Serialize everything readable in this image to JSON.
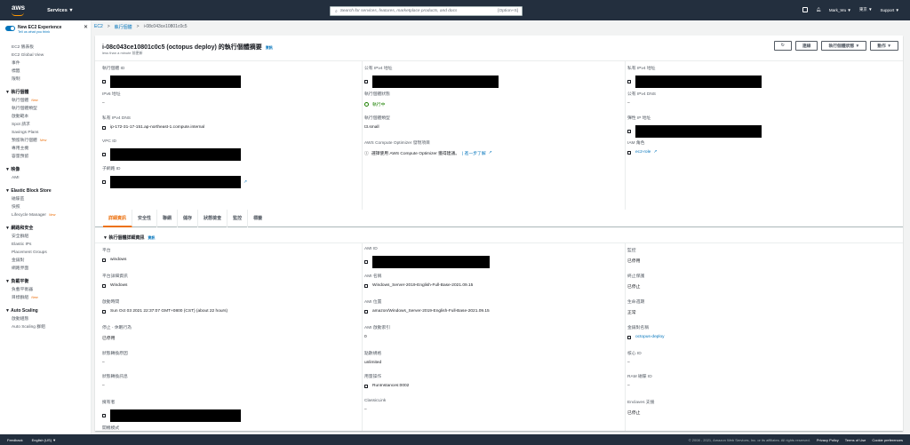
{
  "topbar": {
    "logo": "aws",
    "services_label": "Services ▼",
    "search_placeholder": "Search for services, features, marketplace products, and docs",
    "search_shortcut": "[Option+S]",
    "user": "Mark_Wu ▼",
    "region": "東京 ▼",
    "support": "Support ▼"
  },
  "sidebar": {
    "experience_title": "New EC2 Experience",
    "experience_sub": "Tell us what you think",
    "close": "✕",
    "items": [
      {
        "type": "item",
        "label": "EC2 儀表板"
      },
      {
        "type": "item",
        "label": "EC2 Global View"
      },
      {
        "type": "item",
        "label": "事件"
      },
      {
        "type": "item",
        "label": "標籤"
      },
      {
        "type": "item",
        "label": "限制"
      },
      {
        "type": "section",
        "label": "▼ 執行個體"
      },
      {
        "type": "item",
        "label": "執行個體",
        "badge": "New"
      },
      {
        "type": "item",
        "label": "執行個體類型"
      },
      {
        "type": "item",
        "label": "啟動範本"
      },
      {
        "type": "item",
        "label": "Spot 請求"
      },
      {
        "type": "item",
        "label": "Savings Plans"
      },
      {
        "type": "item",
        "label": "預留執行個體",
        "badge": "New"
      },
      {
        "type": "item",
        "label": "專用主機"
      },
      {
        "type": "item",
        "label": "容量預留"
      },
      {
        "type": "section",
        "label": "▼ 映像"
      },
      {
        "type": "item",
        "label": "AMI"
      },
      {
        "type": "section",
        "label": "▼ Elastic Block Store"
      },
      {
        "type": "item",
        "label": "磁碟區"
      },
      {
        "type": "item",
        "label": "快照"
      },
      {
        "type": "item",
        "label": "Lifecycle Manager",
        "badge": "New"
      },
      {
        "type": "section",
        "label": "▼ 網路和安全"
      },
      {
        "type": "item",
        "label": "安全群組"
      },
      {
        "type": "item",
        "label": "Elastic IPs"
      },
      {
        "type": "item",
        "label": "Placement Groups"
      },
      {
        "type": "item",
        "label": "金鑰對"
      },
      {
        "type": "item",
        "label": "網路界面"
      },
      {
        "type": "section",
        "label": "▼ 負載平衡"
      },
      {
        "type": "item",
        "label": "負載平衡器"
      },
      {
        "type": "item",
        "label": "目標群組",
        "badge": "New"
      },
      {
        "type": "section",
        "label": "▼ Auto Scaling"
      },
      {
        "type": "item",
        "label": "啟動組態"
      },
      {
        "type": "item",
        "label": "Auto Scaling 群組"
      }
    ]
  },
  "breadcrumb": {
    "root": "EC2",
    "sep": ">",
    "item": "執行個體",
    "sep2": ">",
    "current": "i-08c043ce10801c0c5"
  },
  "panel": {
    "title": "i-08c043ce10801c0c5 (octopus deploy) 的執行個體摘要",
    "info": "資訊",
    "subtitle": "less than a minute 前更新",
    "buttons": {
      "refresh": "↻",
      "connect": "連線",
      "state": "執行個體狀態 ▼",
      "actions": "動作 ▼"
    }
  },
  "summary": {
    "instance_id_label": "執行個體 ID",
    "public_ipv4_label": "公有 IPv4 地址",
    "private_ipv4_label": "私有 IPv4 地址",
    "ipv6_label": "IPv6 地址",
    "ipv6_value": "–",
    "state_label": "執行個體狀態",
    "state_value": "執行中",
    "public_dns_label": "公有 IPv4 DNS",
    "public_dns_value": "–",
    "private_dns_label": "私有 IPv4 DNS",
    "private_dns_value": "ip-172-31-17-151.ap-northeast-1.compute.internal",
    "type_label": "執行個體類型",
    "type_value": "t3.small",
    "eip_label": "彈性 IP 地址",
    "vpc_label": "VPC ID",
    "optimizer_label": "AWS Compute Optimizer 發現項目",
    "optimizer_value": "選擇使用 AWS Compute Optimizer 獲得建議。",
    "optimizer_link": "| 進一步了解",
    "iam_label": "IAM 角色",
    "iam_value": "ec2-role",
    "subnet_label": "子網路 ID"
  },
  "tabs": [
    "詳細資訊",
    "安全性",
    "聯網",
    "儲存",
    "狀態檢查",
    "監控",
    "標籤"
  ],
  "details": {
    "section_title": "▼ 執行個體詳細資訊",
    "info": "資訊",
    "platform_label": "平台",
    "platform_value": "windows",
    "ami_id_label": "AMI ID",
    "monitoring_label": "監控",
    "monitoring_value": "已停用",
    "platform_detail_label": "平台詳細資訊",
    "platform_detail_value": "Windows",
    "ami_name_label": "AMI 名稱",
    "ami_name_value": "Windows_Server-2019-English-Full-Base-2021.09.15",
    "term_label": "終止保護",
    "term_value": "已停止",
    "launch_label": "啟動時間",
    "launch_value": "Sun Oct 03 2021 22:37:07 GMT+0800 (CST) (about 22 hours)",
    "ami_loc_label": "AMI 位置",
    "ami_loc_value": "amazon/Windows_Server-2019-English-Full-Base-2021.09.15",
    "lifecycle_label": "生命週期",
    "lifecycle_value": "正常",
    "stop_label": "停止 - 休眠行為",
    "stop_value": "已停用",
    "ami_launch_label": "AMI 啟動索引",
    "ami_launch_value": "0",
    "keypair_label": "金鑰對名稱",
    "keypair_value": "octopus-deploy",
    "trans_reason_label": "狀態轉換原因",
    "trans_reason_value": "–",
    "credit_label": "點數規格",
    "credit_value": "unlimited",
    "kernel_label": "核心 ID",
    "kernel_value": "–",
    "trans_msg_label": "狀態轉換訊息",
    "trans_msg_value": "–",
    "usage_label": "用量操作",
    "usage_value": "RunInstances:0002",
    "ram_label": "RAM 磁碟 ID",
    "ram_value": "–",
    "owner_label": "擁有者",
    "classic_label": "ClassicLink",
    "classic_value": "–",
    "enclaves_label": "Enclaves 支援",
    "enclaves_value": "已停止",
    "boot_label": "開機模式",
    "boot_value": "–"
  },
  "footer": {
    "feedback": "Feedback",
    "language": "English (US) ▼",
    "copyright": "© 2008 - 2021, Amazon Web Services, Inc. or its affiliates. All rights reserved.",
    "privacy": "Privacy Policy",
    "terms": "Terms of Use",
    "cookies": "Cookie preferences"
  },
  "colors": {
    "header": "#232f3e",
    "accent": "#ec7211",
    "link": "#0073bb",
    "running": "#1d8102"
  }
}
